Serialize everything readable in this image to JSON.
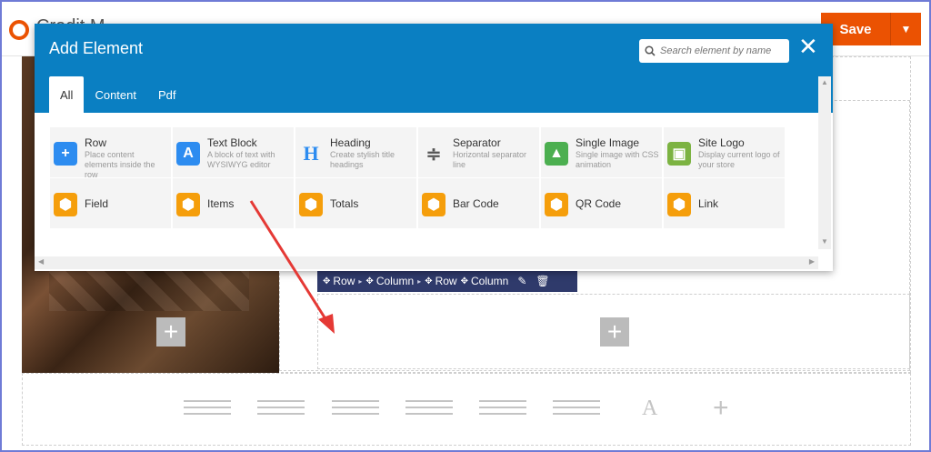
{
  "app": {
    "page_title": "Credit M",
    "save_label": "Save",
    "save_menu_glyph": "▼"
  },
  "modal": {
    "title": "Add Element",
    "search_placeholder": "Search element by name",
    "close_glyph": "✕",
    "tabs": [
      {
        "label": "All",
        "active": true
      },
      {
        "label": "Content",
        "active": false
      },
      {
        "label": "Pdf",
        "active": false
      }
    ],
    "elements": [
      {
        "name": "Row",
        "desc": "Place content elements inside the row",
        "icon": "plus-icon",
        "color": "#2d8cf0",
        "glyph": "+"
      },
      {
        "name": "Text Block",
        "desc": "A block of text with WYSIWYG editor",
        "icon": "text-block-icon",
        "color": "#2d8cf0",
        "glyph": "A"
      },
      {
        "name": "Heading",
        "desc": "Create stylish title headings",
        "icon": "heading-icon",
        "color": "#2d8cf0",
        "glyph": "H"
      },
      {
        "name": "Separator",
        "desc": "Horizontal separator line",
        "icon": "separator-icon",
        "color": "#555555",
        "glyph": "≑"
      },
      {
        "name": "Single Image",
        "desc": "Single image with CSS animation",
        "icon": "image-icon",
        "color": "#4caf50",
        "glyph": "▲"
      },
      {
        "name": "Site Logo",
        "desc": "Display current logo of your store",
        "icon": "site-logo-icon",
        "color": "#7cb342",
        "glyph": "▣"
      },
      {
        "name": "Field",
        "desc": "",
        "icon": "box-icon",
        "color": "#f59e0b",
        "glyph": "⬢"
      },
      {
        "name": "Items",
        "desc": "",
        "icon": "box-icon",
        "color": "#f59e0b",
        "glyph": "⬢"
      },
      {
        "name": "Totals",
        "desc": "",
        "icon": "box-icon",
        "color": "#f59e0b",
        "glyph": "⬢"
      },
      {
        "name": "Bar Code",
        "desc": "",
        "icon": "box-icon",
        "color": "#f59e0b",
        "glyph": "⬢"
      },
      {
        "name": "QR Code",
        "desc": "",
        "icon": "box-icon",
        "color": "#f59e0b",
        "glyph": "⬢"
      },
      {
        "name": "Link",
        "desc": "",
        "icon": "box-icon",
        "color": "#f59e0b",
        "glyph": "⬢"
      }
    ]
  },
  "breadcrumb": {
    "items": [
      "Row",
      "Column",
      "Row",
      "Column"
    ],
    "edit_icon": "pencil-icon",
    "delete_icon": "trash-icon"
  },
  "colors": {
    "header_blue": "#0a7fc2",
    "save_orange": "#eb5202",
    "breadcrumb_navy": "#2f3a6b",
    "arrow_red": "#e53935"
  },
  "layout_options": {
    "text_glyph": "A",
    "add_glyph": "+"
  }
}
